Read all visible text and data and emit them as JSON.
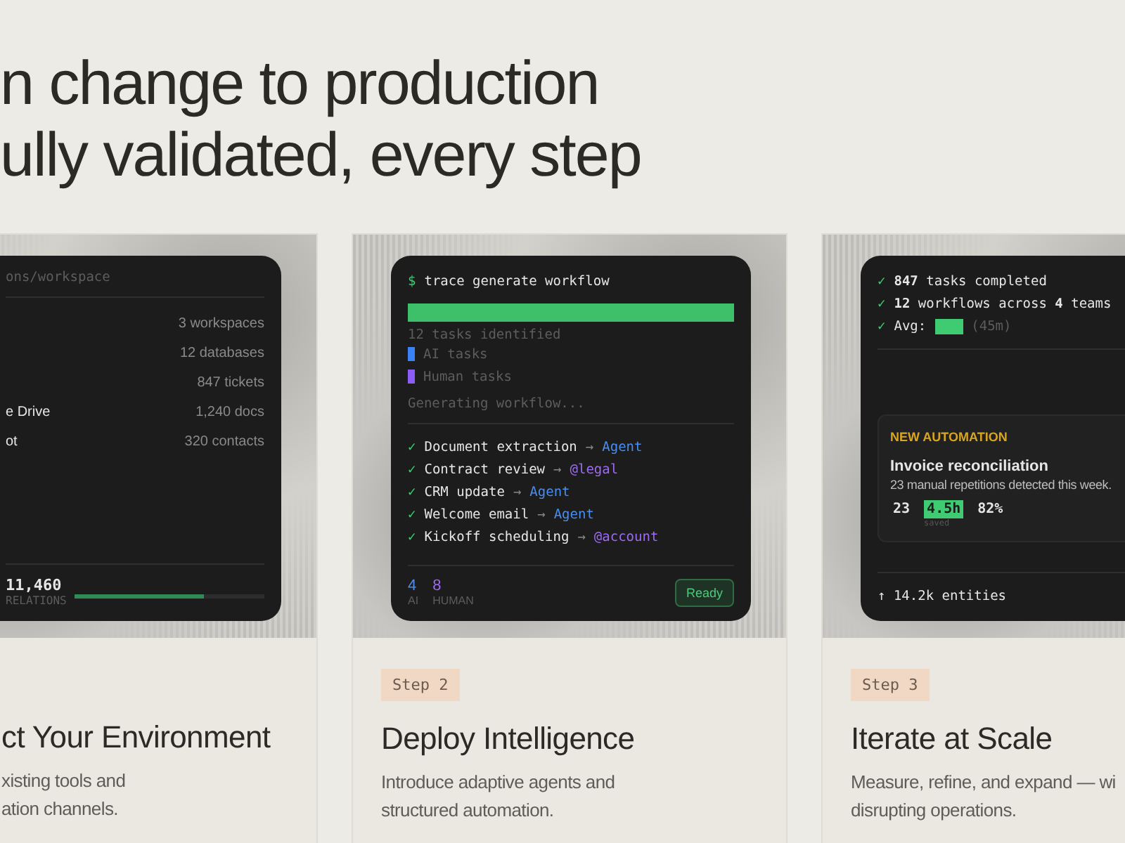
{
  "heading": {
    "lines": [
      "n change to production",
      "ully validated, every step"
    ]
  },
  "cards": [
    {
      "kind": "connect",
      "title": "ct Your Environment",
      "description": [
        "xisting tools and",
        "ation channels."
      ],
      "screen": {
        "path": "ons/workspace",
        "rows": [
          {
            "value": "3 workspaces"
          },
          {
            "value": "12 databases"
          },
          {
            "value": "847 tickets"
          },
          {
            "label": "e Drive",
            "value": "1,240 docs"
          },
          {
            "label": "ot",
            "value": "320 contacts"
          }
        ],
        "total": "11,460",
        "total_label": "RELATIONS",
        "level": 0.68
      }
    },
    {
      "kind": "deploy",
      "step": "Step 2",
      "title": "Deploy Intelligence",
      "description": [
        "Introduce adaptive agents and",
        "structured automation."
      ],
      "screen": {
        "prompt": "$",
        "command": "trace generate workflow",
        "level": 1,
        "identified": "12 tasks identified",
        "legend": [
          {
            "label": "AI tasks",
            "color": "#3b82f6"
          },
          {
            "label": "Human tasks",
            "color": "#8b5cf6"
          }
        ],
        "status": "Generating workflow...",
        "tasks": [
          {
            "check": "✓",
            "task": "Document extraction",
            "arrow": "→",
            "assignee": "Agent",
            "kind": "agent"
          },
          {
            "check": "✓",
            "task": "Contract review",
            "arrow": "→",
            "assignee": "@legal",
            "kind": "human"
          },
          {
            "check": "✓",
            "task": "CRM update",
            "arrow": "→",
            "assignee": "Agent",
            "kind": "agent"
          },
          {
            "check": "✓",
            "task": "Welcome email",
            "arrow": "→",
            "assignee": "Agent",
            "kind": "agent"
          },
          {
            "check": "✓",
            "task": "Kickoff scheduling",
            "arrow": "→",
            "assignee": "@account",
            "kind": "human"
          }
        ],
        "counts": [
          {
            "value": "4",
            "label": "AI",
            "kind": "agent"
          },
          {
            "value": "8",
            "label": "HUMAN",
            "kind": "human"
          }
        ],
        "badge": "Ready"
      }
    },
    {
      "kind": "iterate",
      "step": "Step 3",
      "title": "Iterate at Scale",
      "description": [
        "Measure, refine, and expand — wi",
        "disrupting operations."
      ],
      "screen": {
        "checks": [
          {
            "check": "✓",
            "text": "**847** tasks completed"
          },
          {
            "check": "✓",
            "text": "**12** workflows across **4** teams"
          }
        ],
        "avg": {
          "check": "✓",
          "label": "Avg:",
          "value": "(45m)"
        },
        "automation": {
          "tag": "NEW AUTOMATION",
          "title": "Invoice reconciliation",
          "text": "23 manual repetitions detected this week.",
          "stats": [
            {
              "value": "23",
              "highlighted": false
            },
            {
              "value": "4.5h",
              "highlighted": true,
              "label": "saved"
            },
            {
              "value": "82%",
              "highlighted": false
            }
          ]
        },
        "footer": "↑ 14.2k entities"
      }
    }
  ]
}
